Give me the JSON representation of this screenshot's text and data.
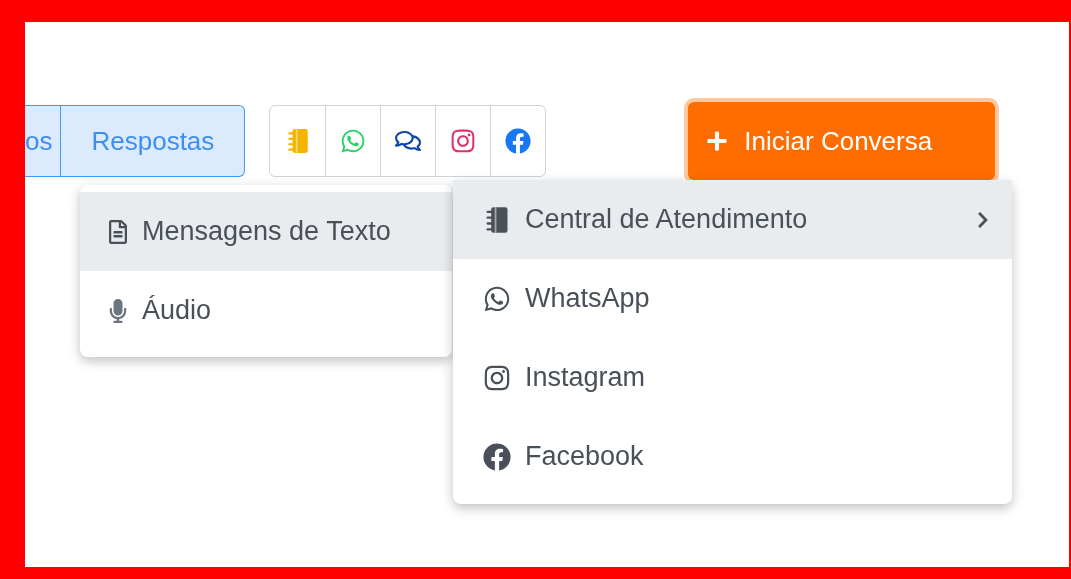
{
  "filter_tabs": [
    {
      "label": "os"
    },
    {
      "label": "Respostas"
    }
  ],
  "channel_buttons": [
    {
      "kind": "central"
    },
    {
      "kind": "whatsapp"
    },
    {
      "kind": "chat"
    },
    {
      "kind": "instagram"
    },
    {
      "kind": "facebook"
    }
  ],
  "start_button": {
    "label": "Iniciar Conversa"
  },
  "type_menu": {
    "items": [
      {
        "label": "Mensagens de Texto",
        "kind": "text",
        "selected": true
      },
      {
        "label": "Áudio",
        "kind": "audio",
        "selected": false
      }
    ]
  },
  "channel_menu": {
    "items": [
      {
        "label": "Central de Atendimento",
        "kind": "central",
        "selected": true,
        "has_submenu": true
      },
      {
        "label": "WhatsApp",
        "kind": "whatsapp",
        "selected": false,
        "has_submenu": false
      },
      {
        "label": "Instagram",
        "kind": "instagram",
        "selected": false,
        "has_submenu": false
      },
      {
        "label": "Facebook",
        "kind": "facebook",
        "selected": false,
        "has_submenu": false
      }
    ]
  }
}
